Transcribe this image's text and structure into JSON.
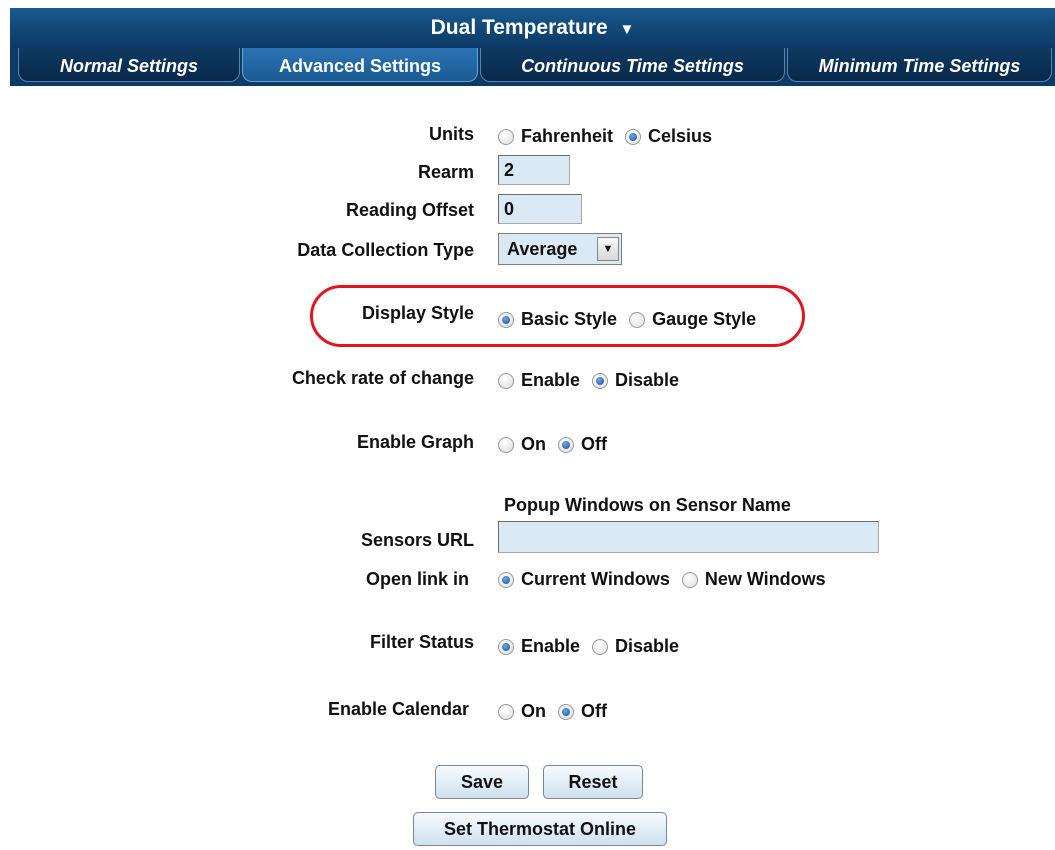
{
  "title": "Dual Temperature",
  "title_arrow": "▼",
  "tabs": [
    "Normal Settings",
    "Advanced Settings",
    "Continuous Time Settings",
    "Minimum Time Settings"
  ],
  "active_tab": "Advanced Settings",
  "form": {
    "units": {
      "label": "Units",
      "opt1": "Fahrenheit",
      "opt2": "Celsius",
      "selected": "Celsius"
    },
    "rearm": {
      "label": "Rearm",
      "value": "2"
    },
    "reading_offset": {
      "label": "Reading Offset",
      "value": "0"
    },
    "data_collection": {
      "label": "Data Collection Type",
      "value": "Average"
    },
    "display_style": {
      "label": "Display Style",
      "opt1": "Basic Style",
      "opt2": "Gauge Style",
      "selected": "Basic Style"
    },
    "rate_of_change": {
      "label": "Check rate of change",
      "opt1": "Enable",
      "opt2": "Disable",
      "selected": "Disable"
    },
    "enable_graph": {
      "label": "Enable Graph",
      "opt1": "On",
      "opt2": "Off",
      "selected": "Off"
    },
    "popup_heading": "Popup Windows on Sensor Name",
    "sensors_url": {
      "label": "Sensors URL",
      "value": ""
    },
    "open_link": {
      "label": "Open link in",
      "opt1": "Current Windows",
      "opt2": "New Windows",
      "selected": "Current Windows"
    },
    "filter_status": {
      "label": "Filter Status",
      "opt1": "Enable",
      "opt2": "Disable",
      "selected": "Enable"
    },
    "enable_calendar": {
      "label": "Enable Calendar",
      "opt1": "On",
      "opt2": "Off",
      "selected": "Off"
    }
  },
  "buttons": {
    "save": "Save",
    "reset": "Reset",
    "thermostat": "Set Thermostat Online"
  },
  "colors": {
    "header": "#0c3a66",
    "active_tab": "#1f63a3",
    "highlight": "#e4141e",
    "field_bg": "#dbe9f4"
  }
}
